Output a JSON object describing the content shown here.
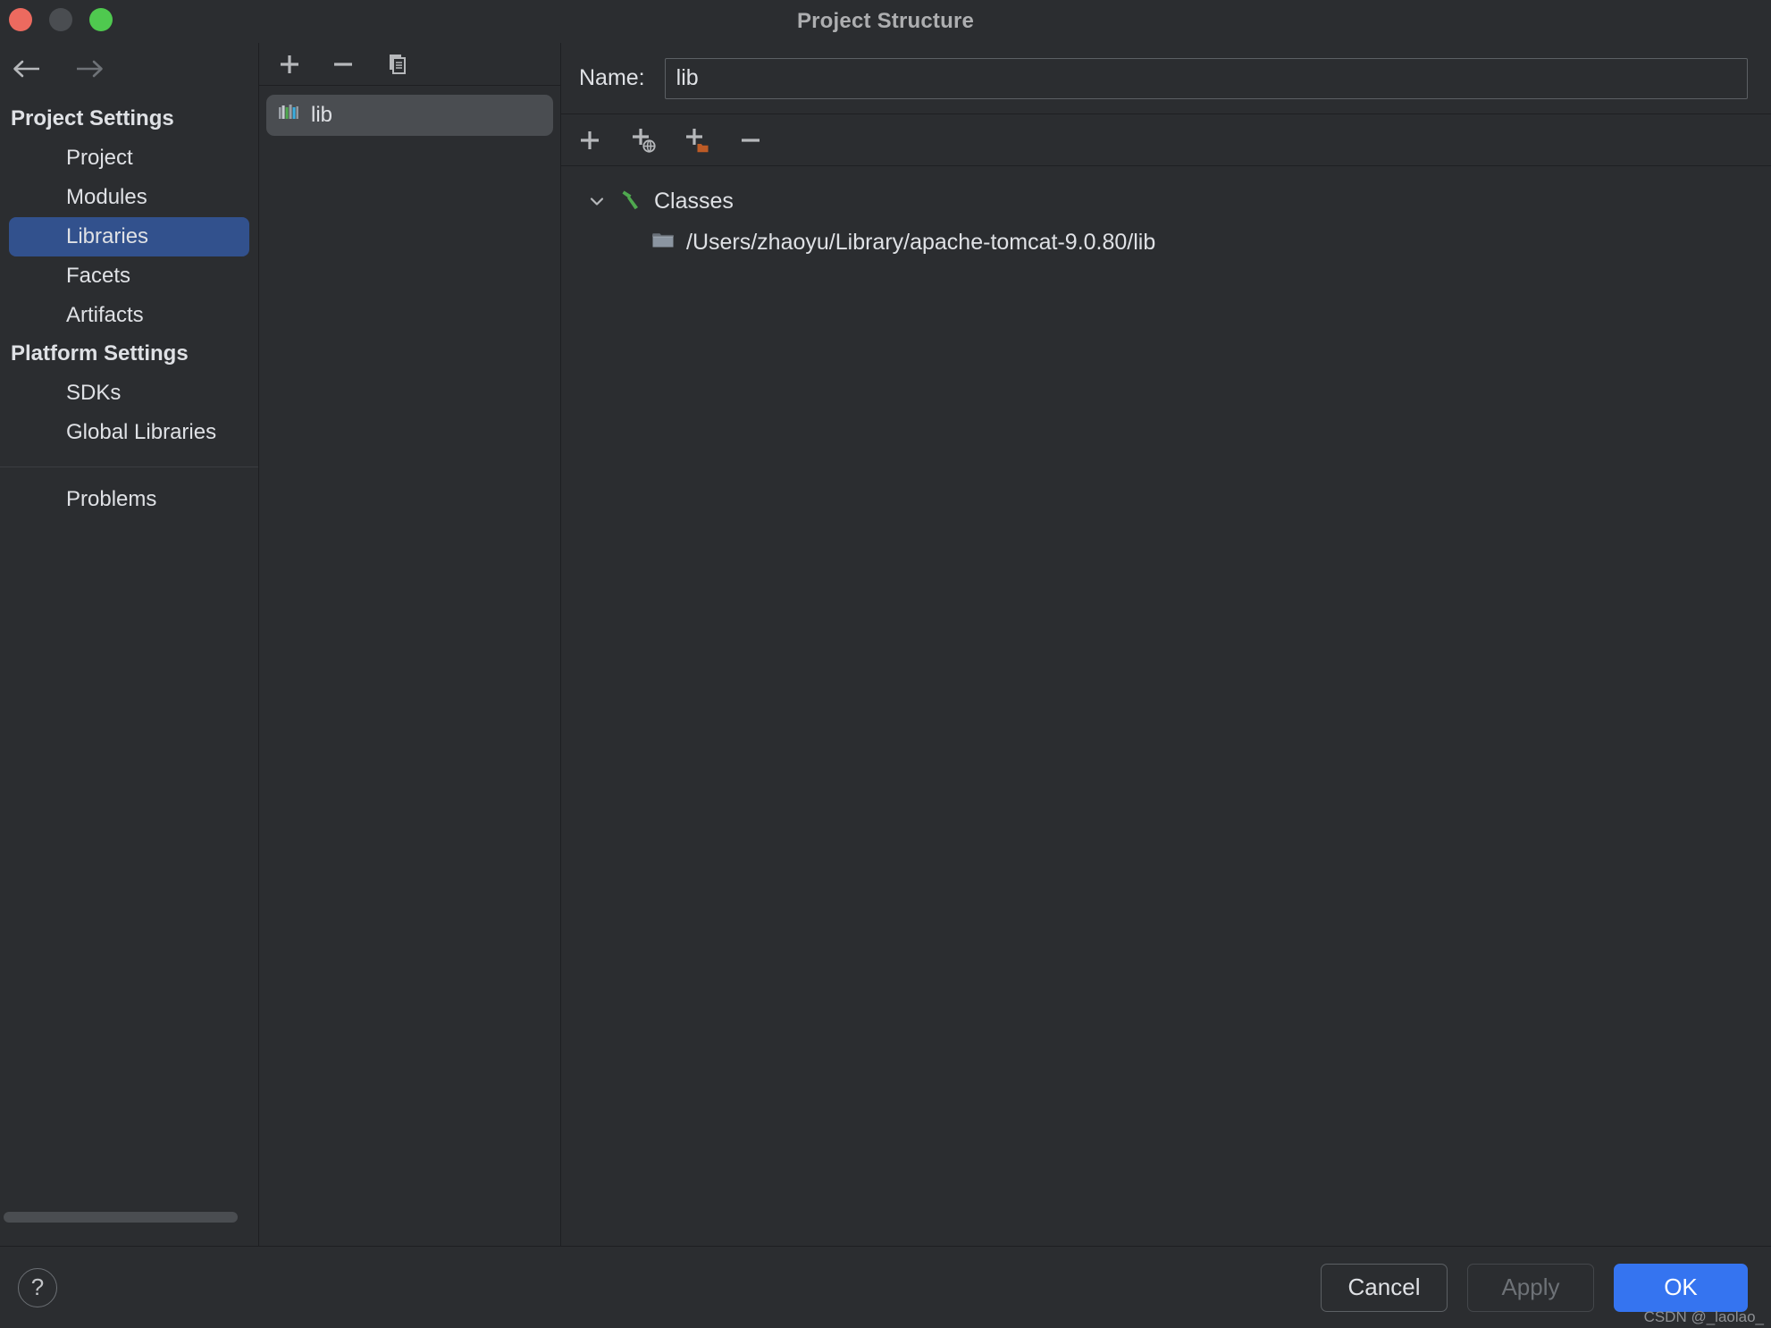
{
  "window": {
    "title": "Project Structure",
    "controls": {
      "close": "close-button",
      "minimize": "minimize-button",
      "zoom": "zoom-button"
    }
  },
  "nav": {
    "back": "back-arrow-icon",
    "forward": "forward-arrow-icon"
  },
  "sidebar": {
    "groups": [
      {
        "title": "Project Settings",
        "items": [
          {
            "label": "Project",
            "selected": false
          },
          {
            "label": "Modules",
            "selected": false
          },
          {
            "label": "Libraries",
            "selected": true
          },
          {
            "label": "Facets",
            "selected": false
          },
          {
            "label": "Artifacts",
            "selected": false
          }
        ]
      },
      {
        "title": "Platform Settings",
        "items": [
          {
            "label": "SDKs",
            "selected": false
          },
          {
            "label": "Global Libraries",
            "selected": false
          }
        ]
      }
    ],
    "problems": {
      "label": "Problems"
    }
  },
  "libraries_panel": {
    "toolbar": [
      {
        "name": "add-library-button",
        "icon": "plus-icon",
        "label": "+"
      },
      {
        "name": "remove-library-button",
        "icon": "minus-icon",
        "label": "−"
      },
      {
        "name": "copy-library-button",
        "icon": "copy-icon",
        "label": "Copy"
      }
    ],
    "items": [
      {
        "label": "lib",
        "icon": "library-icon",
        "selected": true
      }
    ]
  },
  "detail_panel": {
    "name_field": {
      "label": "Name:",
      "value": "lib",
      "placeholder": ""
    },
    "roots_toolbar": [
      {
        "name": "add-root-button",
        "icon": "plus-icon",
        "label": "+"
      },
      {
        "name": "add-maven-root-button",
        "icon": "plus-globe-icon",
        "label": "+"
      },
      {
        "name": "add-directory-root-button",
        "icon": "plus-folder-icon",
        "label": "+"
      },
      {
        "name": "remove-root-button",
        "icon": "minus-icon",
        "label": "−"
      }
    ],
    "tree": {
      "root": {
        "label": "Classes",
        "icon": "hammer-icon",
        "expanded": true,
        "chevron": "chevron-down-icon"
      },
      "children": [
        {
          "label": "/Users/zhaoyu/Library/apache-tomcat-9.0.80/lib",
          "icon": "archive-folder-icon"
        }
      ]
    }
  },
  "footer": {
    "help": {
      "label": "?",
      "icon": "help-icon"
    },
    "buttons": [
      {
        "name": "cancel-button",
        "label": "Cancel",
        "state": "enabled"
      },
      {
        "name": "apply-button",
        "label": "Apply",
        "state": "disabled"
      },
      {
        "name": "ok-button",
        "label": "OK",
        "state": "primary"
      }
    ],
    "watermark": "CSDN @_laolao_"
  },
  "colors": {
    "background": "#2b2d30",
    "selection_blue": "#32518d",
    "primary_blue": "#3574f0",
    "list_selection": "#4a4d51",
    "text": "#dfe1e5",
    "muted_text": "#adaeb0",
    "border": "#1e1f22",
    "accent_green": "#4fa84f",
    "accent_orange": "#bd5b26"
  }
}
